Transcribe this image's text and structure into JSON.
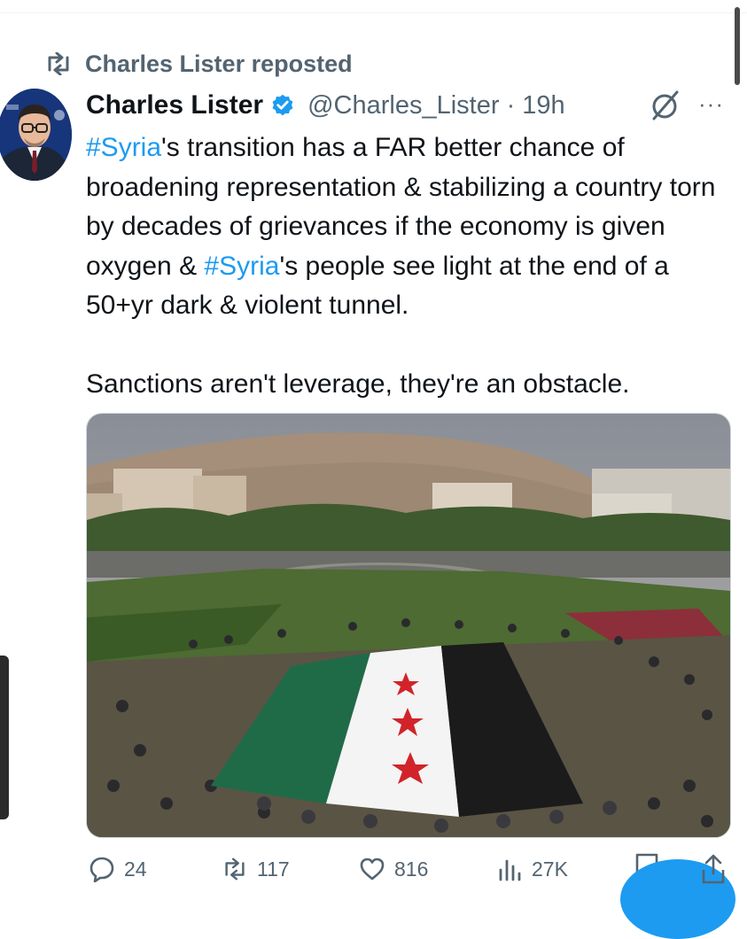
{
  "repost": {
    "label": "Charles Lister reposted"
  },
  "tweet": {
    "author_name": "Charles Lister",
    "handle": "@Charles_Lister",
    "separator": " · ",
    "time": "19h",
    "more_label": "···",
    "paragraph1": {
      "hashtag1": "#Syria",
      "text1": "'s transition has a FAR better chance of broadening representation & stabilizing a country torn by decades of grievances if the economy is given oxygen & ",
      "hashtag2": "#Syria",
      "text2": "'s people see light at the end of a 50+yr dark & violent tunnel."
    },
    "paragraph2": "Sanctions aren't leverage, they're an obstacle."
  },
  "actions": {
    "replies": "24",
    "reposts": "117",
    "likes": "816",
    "views": "27K"
  },
  "flag_colors": {
    "green": "#1f6b47",
    "white": "#f4f4f4",
    "black": "#1b1b1b",
    "star": "#d2232a"
  },
  "accent_color": "#1d9bf0"
}
